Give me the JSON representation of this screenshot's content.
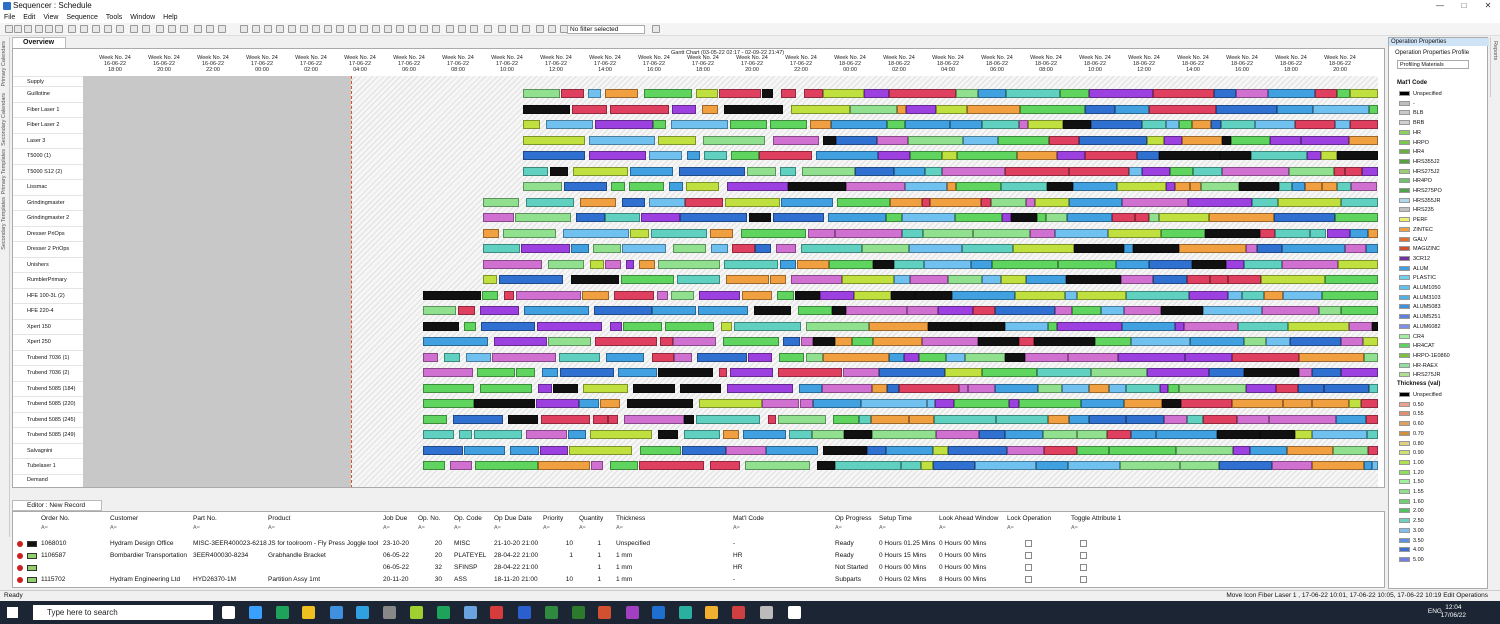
{
  "window": {
    "title": "Sequencer : Schedule"
  },
  "menu": [
    "File",
    "Edit",
    "View",
    "Sequence",
    "Tools",
    "Window",
    "Help"
  ],
  "toolbar": {
    "filter_value": "No filter selected"
  },
  "left_tabs": [
    "Primary Calendars",
    "Secondary Calendars",
    "Primary Templates",
    "Secondary Templates"
  ],
  "overview_tab": "Overview",
  "gantt": {
    "label": "Gantt Chart   (03-05-22 02:17 - 02-09-22 21:47)",
    "week_label": "Week No. 24",
    "columns": [
      {
        "date": "16-06-22",
        "time": "18:00"
      },
      {
        "date": "16-06-22",
        "time": "20:00"
      },
      {
        "date": "16-06-22",
        "time": "22:00"
      },
      {
        "date": "17-06-22",
        "time": "00:00"
      },
      {
        "date": "17-06-22",
        "time": "02:00"
      },
      {
        "date": "17-06-22",
        "time": "04:00"
      },
      {
        "date": "17-06-22",
        "time": "06:00"
      },
      {
        "date": "17-06-22",
        "time": "08:00"
      },
      {
        "date": "17-06-22",
        "time": "10:00"
      },
      {
        "date": "17-06-22",
        "time": "12:00"
      },
      {
        "date": "17-06-22",
        "time": "14:00"
      },
      {
        "date": "17-06-22",
        "time": "16:00"
      },
      {
        "date": "17-06-22",
        "time": "18:00"
      },
      {
        "date": "17-06-22",
        "time": "20:00"
      },
      {
        "date": "17-06-22",
        "time": "22:00"
      },
      {
        "date": "18-06-22",
        "time": "00:00"
      },
      {
        "date": "18-06-22",
        "time": "02:00"
      },
      {
        "date": "18-06-22",
        "time": "04:00"
      },
      {
        "date": "18-06-22",
        "time": "06:00"
      },
      {
        "date": "18-06-22",
        "time": "08:00"
      },
      {
        "date": "18-06-22",
        "time": "10:00"
      },
      {
        "date": "18-06-22",
        "time": "12:00"
      },
      {
        "date": "18-06-22",
        "time": "14:00"
      },
      {
        "date": "18-06-22",
        "time": "16:00"
      },
      {
        "date": "18-06-22",
        "time": "18:00"
      },
      {
        "date": "18-06-22",
        "time": "20:00"
      }
    ],
    "resources": [
      "Supply",
      "Guillotine",
      "Fiber Laser 1",
      "Fiber Laser 2",
      "Laser 3",
      "T5000 (1)",
      "T5000 S12 (2)",
      "Lissmac",
      "Grindingmaster",
      "Grindingmaster 2",
      "Dresser PriOps",
      "Dresser 2 PriOps",
      "Unishers",
      "RumblerPrimary",
      "HFE 100-3L (2)",
      "HFE 220-4",
      "Xpert 150",
      "Xpert 250",
      "Trubend 7036 (1)",
      "Trubend 7036 (2)",
      "Trubend 5085 (184)",
      "Trubend 5085 (220)",
      "Trubend 5085 (245)",
      "Trubend 5085 (249)",
      "Salvagnini",
      "Tubelaser 1",
      "Demand"
    ]
  },
  "editor": {
    "tab": "Editor : New Record",
    "columns": [
      "Order No.",
      "Customer",
      "Part No.",
      "Product",
      "Job Due",
      "Op. No.",
      "Op. Code",
      "Op Due Date",
      "Priority",
      "Quantity",
      "Thickness",
      "Mat'l Code",
      "Op Progress",
      "Setup Time",
      "Look Ahead Window",
      "Lock Operation",
      "Toggle Attribute 1"
    ],
    "filter_hint": "A≈",
    "rows": [
      {
        "order": "1068010",
        "customer": "Hydram Design Office",
        "part": "MISC-3EER400023-6218",
        "product": "JS for toolroom - Fly Press Joggle tool",
        "job_due": "23-10-20",
        "op_no": "20",
        "op_code": "MISC",
        "op_due": "21-10-20 21:00",
        "priority": "10",
        "quantity": "1",
        "thickness": "Unspecified",
        "matl": "-",
        "progress": "Ready",
        "setup": "0 Hours 01.25 Mins",
        "lookahead": "0 Hours 00 Mins"
      },
      {
        "order": "1106587",
        "customer": "Bombardier Transportation",
        "part": "3EER400030-8234",
        "product": "Grabhandle Bracket",
        "job_due": "06-05-22",
        "op_no": "20",
        "op_code": "PLATEYEL",
        "op_due": "28-04-22 21:00",
        "priority": "1",
        "quantity": "1",
        "thickness": "1 mm",
        "matl": "HR",
        "progress": "Ready",
        "setup": "0 Hours 15 Mins",
        "lookahead": "0 Hours 00 Mins"
      },
      {
        "order": "",
        "customer": "",
        "part": "",
        "product": "",
        "job_due": "06-05-22",
        "op_no": "32",
        "op_code": "SFINSP",
        "op_due": "28-04-22 21:00",
        "priority": "",
        "quantity": "1",
        "thickness": "1 mm",
        "matl": "HR",
        "progress": "Not Started",
        "setup": "0 Hours 00 Mins",
        "lookahead": "0 Hours 00 Mins"
      },
      {
        "order": "1115702",
        "customer": "Hydram Engineering Ltd",
        "part": "HYD26370-1M",
        "product": "Partition Assy 1mt",
        "job_due": "20-11-20",
        "op_no": "30",
        "op_code": "ASS",
        "op_due": "18-11-20 21:00",
        "priority": "10",
        "quantity": "1",
        "thickness": "1 mm",
        "matl": "-",
        "progress": "Subparts",
        "setup": "0 Hours 02 Mins",
        "lookahead": "8 Hours 00 Mins"
      }
    ]
  },
  "right_panel": {
    "title": "Operation Properties",
    "subtitle": "Operation Properties Profile",
    "profile": "Profiling Materials",
    "matl_section": "Mat'l Code",
    "matl_items": [
      {
        "name": "Unspecified",
        "color": "#000000"
      },
      {
        "name": "-",
        "color": "#bfbfbf"
      },
      {
        "name": "BLB",
        "color": "#c8c8c8"
      },
      {
        "name": "BRB",
        "color": "#d0d0d0"
      },
      {
        "name": "HR",
        "color": "#90d060"
      },
      {
        "name": "HRPO",
        "color": "#7ac850"
      },
      {
        "name": "HR4",
        "color": "#6ab040"
      },
      {
        "name": "HRS355J2",
        "color": "#5aa040"
      },
      {
        "name": "HRS275J2",
        "color": "#9ad070"
      },
      {
        "name": "HR4PO",
        "color": "#70c070"
      },
      {
        "name": "HRS275PO",
        "color": "#50a050"
      },
      {
        "name": "HRS355JR",
        "color": "#b0d8f0"
      },
      {
        "name": "HRS235",
        "color": "#c0c0c0"
      },
      {
        "name": "PERF",
        "color": "#f0f070"
      },
      {
        "name": "ZINTEC",
        "color": "#f0a040"
      },
      {
        "name": "GALV",
        "color": "#e07030"
      },
      {
        "name": "MAGIZINC",
        "color": "#d05030"
      },
      {
        "name": "3CR12",
        "color": "#7030a0"
      },
      {
        "name": "ALUM",
        "color": "#40a0e0"
      },
      {
        "name": "PLASTIC",
        "color": "#70d0f0"
      },
      {
        "name": "ALUM1050",
        "color": "#60c0f0"
      },
      {
        "name": "ALUM3103",
        "color": "#50b0e8"
      },
      {
        "name": "ALUM5083",
        "color": "#4090e0"
      },
      {
        "name": "ALUM5251",
        "color": "#6080e0"
      },
      {
        "name": "ALUM6082",
        "color": "#8090e8"
      },
      {
        "name": "CR4",
        "color": "#a0f0a0"
      },
      {
        "name": "HR4CAT",
        "color": "#60d060"
      },
      {
        "name": "HRPO-1E0860",
        "color": "#80c040"
      },
      {
        "name": "HR-RAEX",
        "color": "#90e0a0"
      },
      {
        "name": "HRS275JR",
        "color": "#b0e090"
      }
    ],
    "thickness_section": "Thickness (val)",
    "thickness_items": [
      {
        "name": "Unspecified",
        "color": "#000000"
      },
      {
        "name": "0.50",
        "color": "#f0a090"
      },
      {
        "name": "0.55",
        "color": "#e09070"
      },
      {
        "name": "0.60",
        "color": "#e0a060"
      },
      {
        "name": "0.70",
        "color": "#d09040"
      },
      {
        "name": "0.80",
        "color": "#e0d080"
      },
      {
        "name": "0.90",
        "color": "#d0e070"
      },
      {
        "name": "1.00",
        "color": "#b0e050"
      },
      {
        "name": "1.20",
        "color": "#90e060"
      },
      {
        "name": "1.50",
        "color": "#a0f0a0"
      },
      {
        "name": "1.55",
        "color": "#90e090"
      },
      {
        "name": "1.60",
        "color": "#70d070"
      },
      {
        "name": "2.00",
        "color": "#50c060"
      },
      {
        "name": "2.50",
        "color": "#70d0c0"
      },
      {
        "name": "3.00",
        "color": "#80c0f0"
      },
      {
        "name": "3.50",
        "color": "#6090e0"
      },
      {
        "name": "4.00",
        "color": "#4070d0"
      },
      {
        "name": "5.00",
        "color": "#7080e0"
      }
    ]
  },
  "reports_tab": "Reports",
  "status": {
    "left": "Ready",
    "right": "Move Icon  Fiber Laser 1 , 17-06-22 10:01, 17-06-22 10:05, 17-06-22 10:19   Edit Operations"
  },
  "taskbar": {
    "search_placeholder": "Type here to search",
    "lang": "ENG",
    "time": "12:04",
    "date": "17/06/22"
  }
}
